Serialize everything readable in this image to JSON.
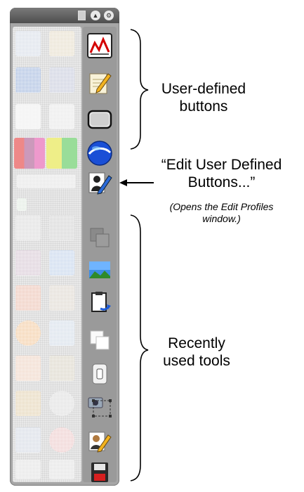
{
  "annotations": {
    "user_defined": [
      "User-defined",
      "buttons"
    ],
    "edit_button": [
      "“Edit User Defined",
      "Buttons...”"
    ],
    "edit_note": [
      "(Opens the Edit Profiles",
      "window.)"
    ],
    "recent_tools": [
      "Recently",
      "used tools"
    ]
  },
  "palette": {
    "title_buttons": [
      "doc-icon",
      "up-arrow-icon",
      "settings-icon"
    ],
    "user_defined_buttons": [
      "chart-icon",
      "notepad-pencil-icon",
      "rounded-rect-icon",
      "globe-icon"
    ],
    "edit_button_icon": "user-profile-pen-icon",
    "recent_tools": [
      "group-squares-icon",
      "landscape-image-icon",
      "clipboard-arrow-icon",
      "duplicate-squares-icon",
      "toggle-switch-icon",
      "camera-selection-icon",
      "profile-pen-icon",
      "floppy-save-icon"
    ]
  },
  "colors": {
    "palette_frame": "#a6a6a6",
    "titlebar": "#5e5e5e",
    "recent_panel": "#e9e9e9"
  }
}
